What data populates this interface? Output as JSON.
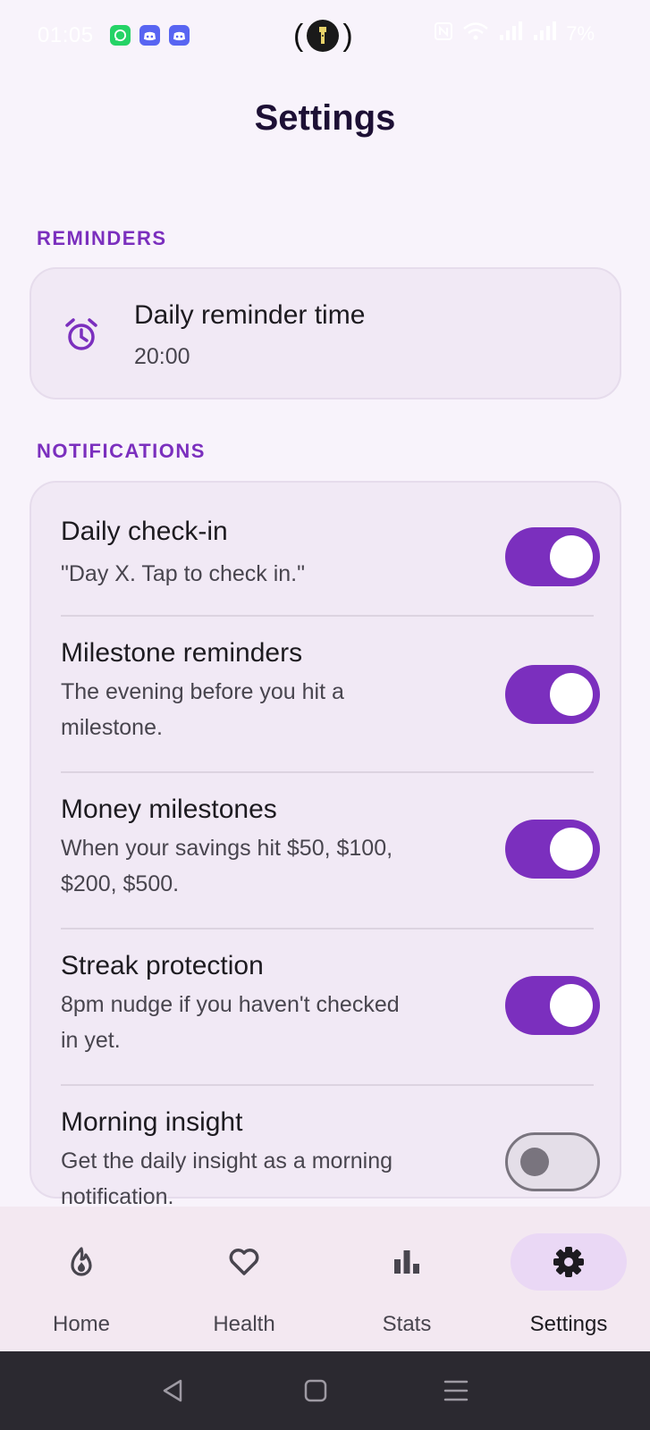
{
  "status_bar": {
    "time": "01:05",
    "notification_apps": [
      "whatsapp-icon",
      "discord-icon",
      "discord-icon"
    ],
    "battery": "7%"
  },
  "header": {
    "title": "Settings"
  },
  "reminders": {
    "section_label": "REMINDERS",
    "item": {
      "title": "Daily reminder time",
      "value": "20:00",
      "icon": "alarm-clock-icon"
    }
  },
  "notifications": {
    "section_label": "NOTIFICATIONS",
    "items": [
      {
        "title": "Daily check-in",
        "description": "\"Day X. Tap to check in.\"",
        "enabled": true
      },
      {
        "title": "Milestone reminders",
        "description": "The evening before you hit a milestone.",
        "enabled": true
      },
      {
        "title": "Money milestones",
        "description": "When your savings hit $50, $100, $200, $500.",
        "enabled": true
      },
      {
        "title": "Streak protection",
        "description": "8pm nudge if you haven't checked in yet.",
        "enabled": true
      },
      {
        "title": "Morning insight",
        "description": "Get the daily insight as a morning notification.",
        "enabled": false
      }
    ]
  },
  "bottom_nav": {
    "items": [
      {
        "label": "Home",
        "icon": "flame-icon",
        "active": false
      },
      {
        "label": "Health",
        "icon": "heart-icon",
        "active": false
      },
      {
        "label": "Stats",
        "icon": "bar-chart-icon",
        "active": false
      },
      {
        "label": "Settings",
        "icon": "gear-icon",
        "active": true
      }
    ]
  },
  "colors": {
    "accent": "#7b2fbe",
    "background": "#f8f3fb",
    "card": "#f1e9f5",
    "nav_background": "#f3e8f1",
    "active_pill": "#ead8f5"
  }
}
